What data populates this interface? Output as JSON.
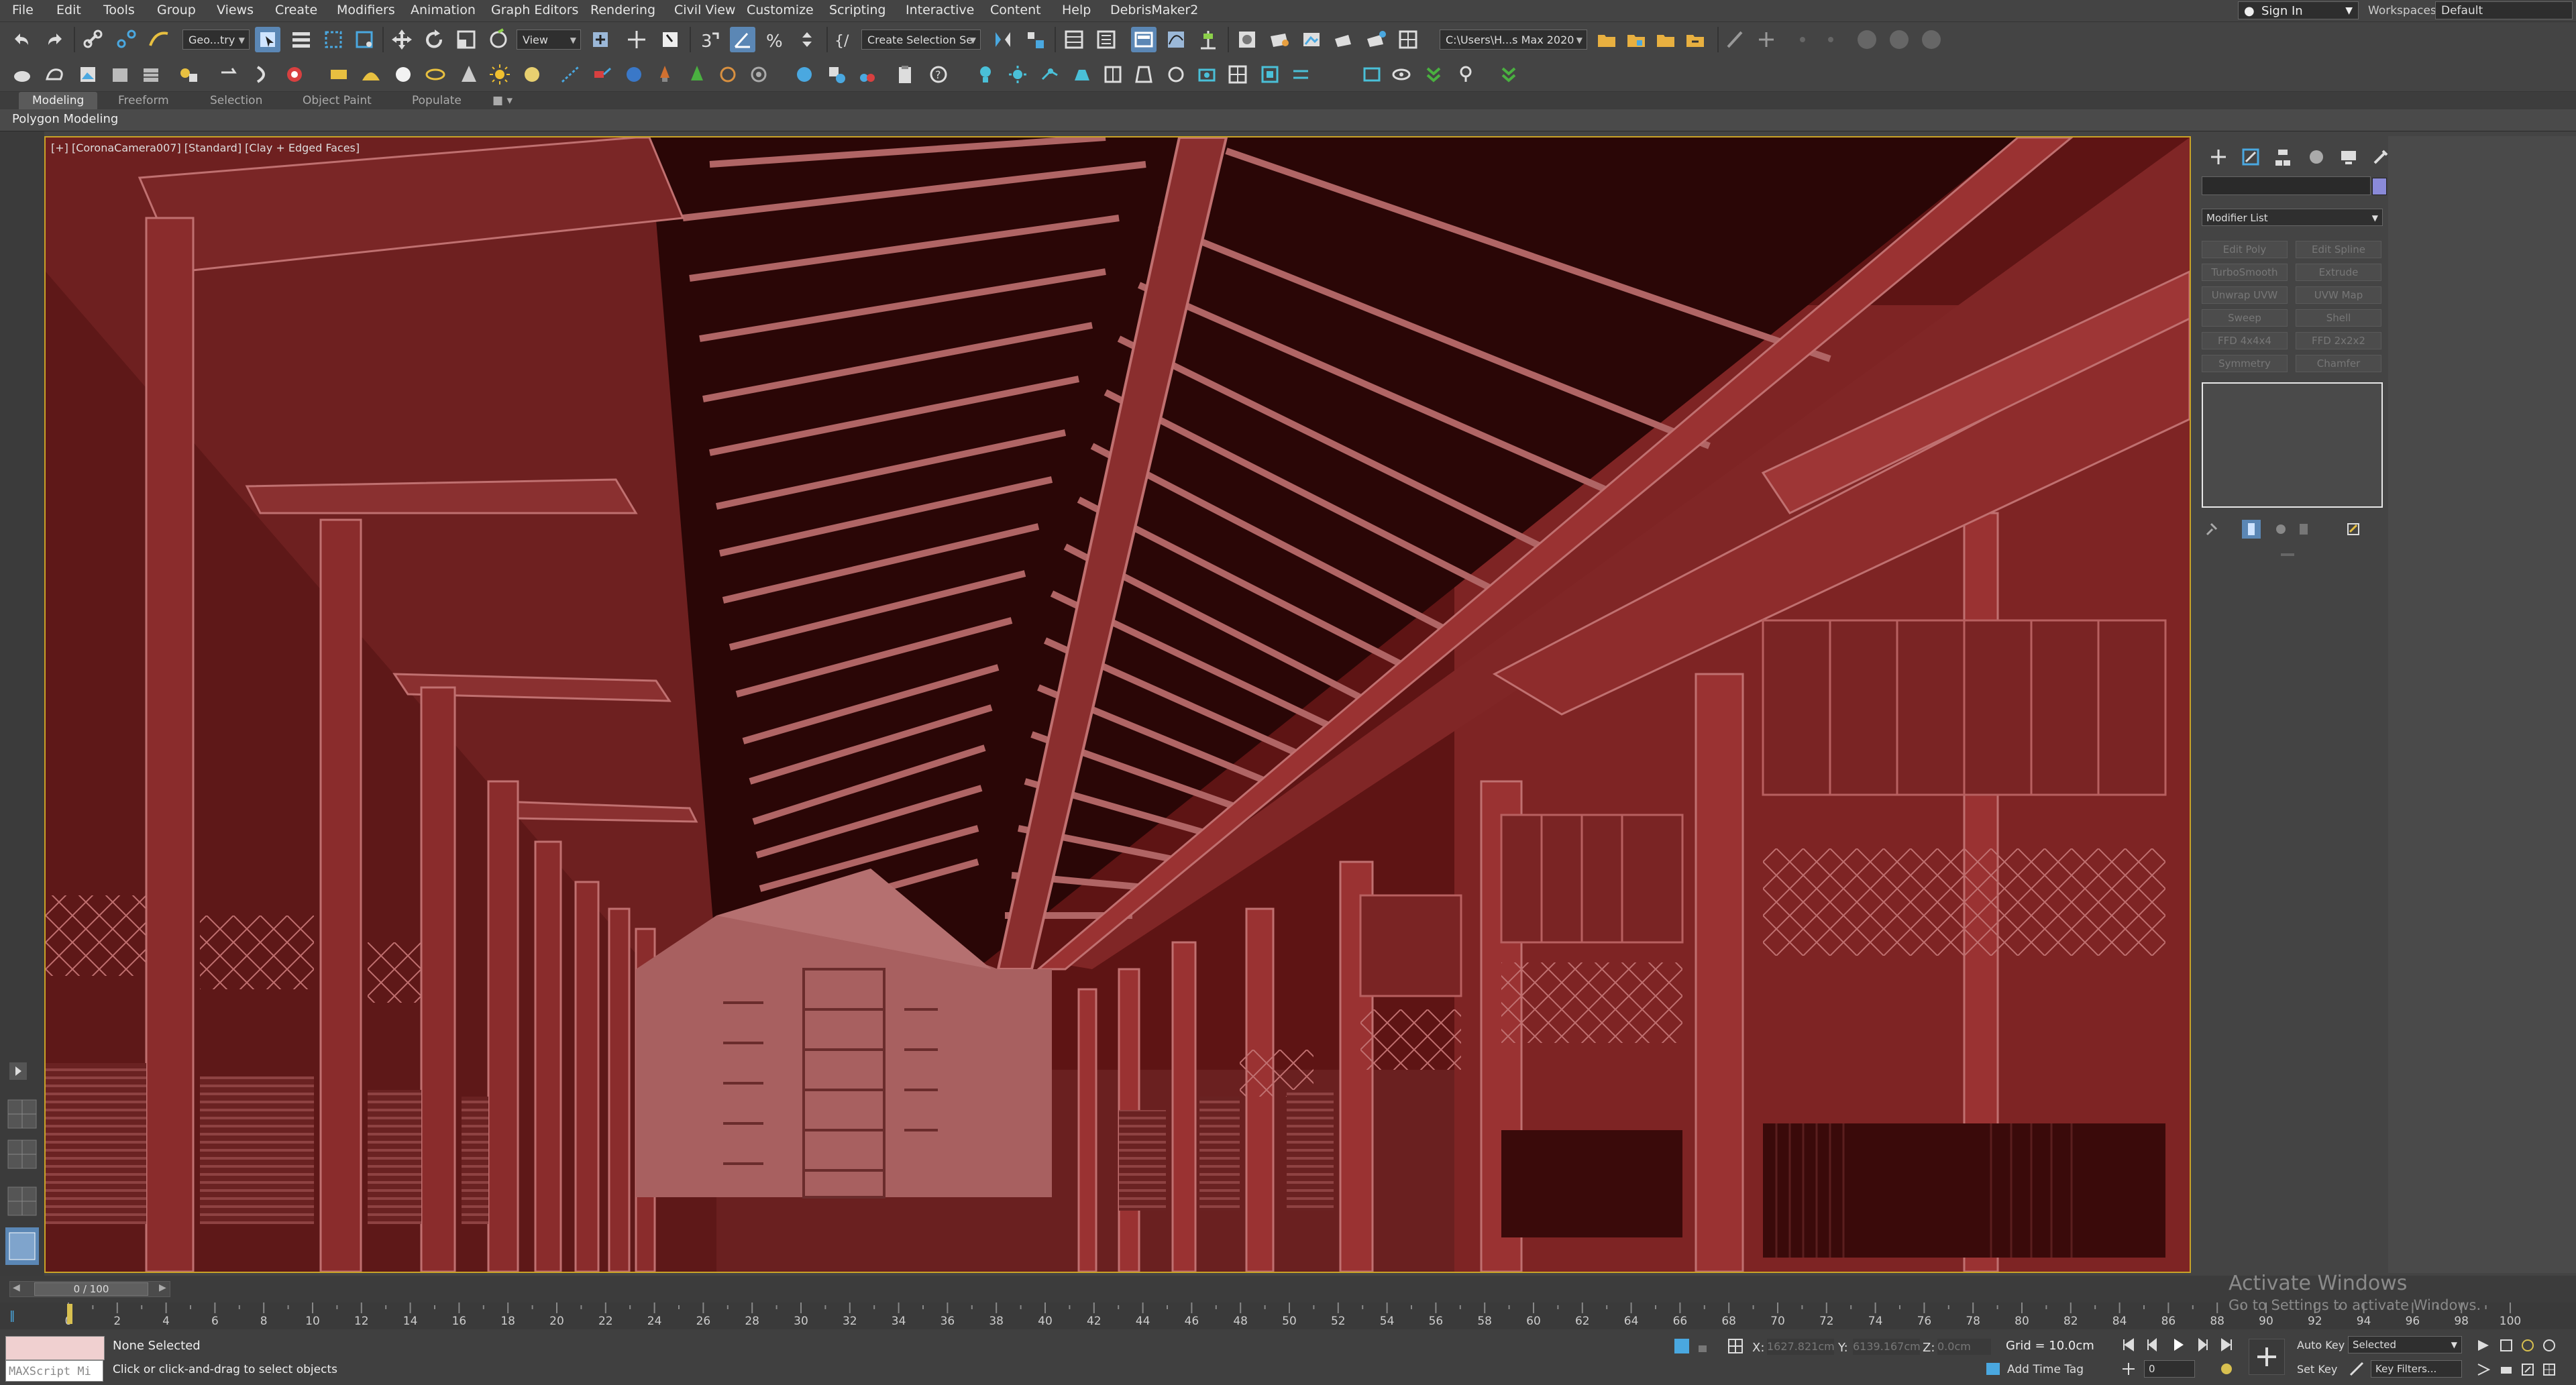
{
  "menu": {
    "items": [
      "File",
      "Edit",
      "Tools",
      "Group",
      "Views",
      "Create",
      "Modifiers",
      "Animation",
      "Graph Editors",
      "Rendering",
      "Civil View",
      "Customize",
      "Scripting",
      "Interactive",
      "Content",
      "Help",
      "DebrisMaker2"
    ],
    "sign_in": "Sign In",
    "workspaces_label": "Workspaces:",
    "workspaces_value": "Default"
  },
  "toolbar": {
    "selection_filter": "Geo...try",
    "ref_coord": "View",
    "named_selection": "Create Selection Se",
    "project_path": "C:\\Users\\H...s Max 2020"
  },
  "ribbon": {
    "tabs": [
      "Modeling",
      "Freeform",
      "Selection",
      "Object Paint",
      "Populate"
    ],
    "panel_label": "Polygon Modeling"
  },
  "viewport": {
    "label": "[+] [CoronaCamera007] [Standard] [Clay + Edged Faces]"
  },
  "command_panel": {
    "modifier_list": "Modifier List",
    "buttons": [
      [
        "Edit Poly",
        "Edit Spline"
      ],
      [
        "TurboSmooth",
        "Extrude"
      ],
      [
        "Unwrap UVW",
        "UVW Map"
      ],
      [
        "Sweep",
        "Shell"
      ],
      [
        "FFD 4x4x4",
        "FFD 2x2x2"
      ],
      [
        "Symmetry",
        "Chamfer"
      ]
    ]
  },
  "time_slider": {
    "frame": "0 / 100",
    "activate_title": "Activate Windows",
    "activate_sub": "Go to Settings to activate Windows."
  },
  "trackbar": {
    "ticks": [
      "0",
      "2",
      "4",
      "6",
      "8",
      "10",
      "12",
      "14",
      "16",
      "18",
      "20",
      "22",
      "24",
      "26",
      "28",
      "30",
      "32",
      "34",
      "36",
      "38",
      "40",
      "42",
      "44",
      "46",
      "48",
      "50",
      "52",
      "54",
      "56",
      "58",
      "60",
      "62",
      "64",
      "66",
      "68",
      "70",
      "72",
      "74",
      "76",
      "78",
      "80",
      "82",
      "84",
      "86",
      "88",
      "90",
      "92",
      "94",
      "96",
      "98",
      "100"
    ]
  },
  "status": {
    "maxscript": "MAXScript Mi",
    "selection": "None Selected",
    "prompt": "Click or click-and-drag to select objects",
    "x_label": "X:",
    "x_value": "1627.821cm",
    "y_label": "Y:",
    "y_value": "6139.167cm",
    "z_label": "Z:",
    "z_value": "0.0cm",
    "grid": "Grid = 10.0cm",
    "add_time_tag": "Add Time Tag",
    "auto_key": "Auto Key",
    "set_key": "Set Key",
    "key_mode": "Selected",
    "key_filters": "Key Filters...",
    "frame_field": "0"
  },
  "colors": {
    "viewport_border": "#c9a227",
    "clay_red": "#7a1f1f"
  }
}
